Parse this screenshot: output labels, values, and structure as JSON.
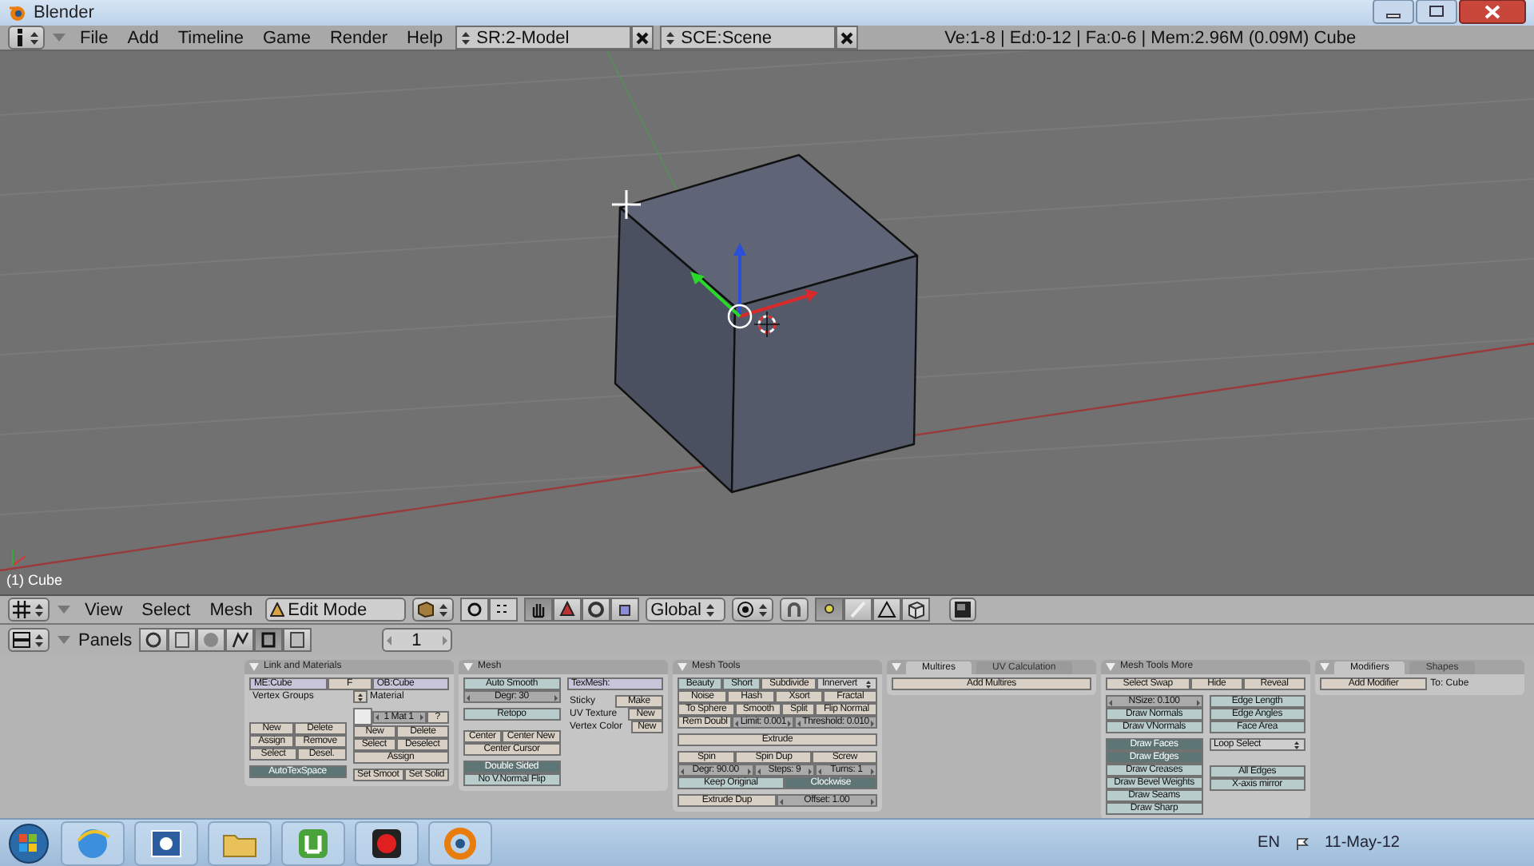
{
  "window": {
    "title": "Blender"
  },
  "info_header": {
    "menus": [
      "File",
      "Add",
      "Timeline",
      "Game",
      "Render",
      "Help"
    ],
    "screen": "SR:2-Model",
    "scene": "SCE:Scene",
    "stats": "Ve:1-8 | Ed:0-12 | Fa:0-6 | Mem:2.96M (0.09M) Cube"
  },
  "viewport": {
    "object_label": "(1) Cube"
  },
  "view_header": {
    "menus": [
      "View",
      "Select",
      "Mesh"
    ],
    "mode": "Edit Mode",
    "orientation": "Global",
    "tools": [
      {
        "selected": true
      },
      {
        "selected": false
      },
      {
        "selected": false
      },
      {
        "selected": false
      }
    ],
    "select_modes": [
      {
        "selected": true
      },
      {
        "selected": false
      },
      {
        "selected": false
      }
    ]
  },
  "buttons_header": {
    "label": "Panels",
    "contexts": [
      {
        "selected": false
      },
      {
        "selected": false
      },
      {
        "selected": false
      },
      {
        "selected": false
      },
      {
        "selected": true
      },
      {
        "selected": false
      }
    ],
    "frame": "1"
  },
  "panels": [
    {
      "title": "Link and Materials",
      "rows": [
        [
          {
            "kind": "field",
            "label": "ME:Cube"
          },
          {
            "kind": "button",
            "label": "F"
          },
          {
            "kind": "field",
            "label": "OB:Cube"
          }
        ]
      ],
      "left": {
        "rows": [
          [
            {
              "kind": "text",
              "label": "Vertex Groups"
            }
          ],
          [
            {
              "kind": "spacer"
            }
          ],
          [
            {
              "kind": "spacer"
            }
          ],
          [
            {
              "kind": "spacer"
            }
          ],
          [
            {
              "kind": "spacer"
            }
          ],
          [
            {
              "kind": "button",
              "label": "New"
            },
            {
              "kind": "button",
              "label": "Delete"
            }
          ],
          [
            {
              "kind": "button",
              "label": "Assign"
            },
            {
              "kind": "button",
              "label": "Remove"
            }
          ],
          [
            {
              "kind": "button",
              "label": "Select"
            },
            {
              "kind": "button",
              "label": "Desel."
            }
          ],
          [
            {
              "kind": "spacer"
            }
          ],
          [
            {
              "kind": "toggle",
              "label": "AutoTexSpace",
              "on": true
            }
          ]
        ]
      },
      "right": {
        "rows": [
          [
            {
              "kind": "menu_icon"
            },
            {
              "kind": "text",
              "label": "Material"
            }
          ],
          [
            {
              "kind": "spacer"
            }
          ],
          [
            {
              "kind": "swatch"
            },
            {
              "kind": "number",
              "label": "1 Mat 1"
            },
            {
              "kind": "button",
              "label": "?"
            }
          ],
          [
            {
              "kind": "button",
              "label": "New"
            },
            {
              "kind": "button",
              "label": "Delete"
            }
          ],
          [
            {
              "kind": "button",
              "label": "Select"
            },
            {
              "kind": "button",
              "label": "Deselect"
            }
          ],
          [
            {
              "kind": "button",
              "label": "Assign"
            }
          ],
          [
            {
              "kind": "spacer"
            }
          ],
          [
            {
              "kind": "button",
              "label": "Set Smoot"
            },
            {
              "kind": "button",
              "label": "Set Solid"
            }
          ]
        ]
      }
    },
    {
      "title": "Mesh",
      "left": {
        "rows": [
          [
            {
              "kind": "toggle",
              "label": "Auto Smooth",
              "on": false
            }
          ],
          [
            {
              "kind": "number",
              "label": "Degr: 30"
            }
          ],
          [
            {
              "kind": "spacer"
            }
          ],
          [
            {
              "kind": "toggle",
              "label": "Retopo",
              "on": false
            }
          ],
          [
            {
              "kind": "spacer"
            }
          ],
          [
            {
              "kind": "spacer"
            }
          ],
          [
            {
              "kind": "button",
              "label": "Center"
            },
            {
              "kind": "button",
              "label": "Center New"
            }
          ],
          [
            {
              "kind": "button",
              "label": "Center Cursor"
            }
          ],
          [
            {
              "kind": "spacer"
            }
          ],
          [
            {
              "kind": "toggle",
              "label": "Double Sided",
              "on": true
            }
          ],
          [
            {
              "kind": "toggle",
              "label": "No V.Normal Flip",
              "on": false
            }
          ]
        ]
      },
      "right": {
        "rows": [
          [
            {
              "kind": "field",
              "label": "TexMesh:"
            }
          ],
          [
            {
              "kind": "spacer"
            }
          ],
          [
            {
              "kind": "text",
              "label": "Sticky"
            },
            {
              "kind": "button",
              "label": "Make"
            }
          ],
          [
            {
              "kind": "text",
              "label": "UV Texture"
            },
            {
              "kind": "button",
              "label": "New"
            }
          ],
          [
            {
              "kind": "text",
              "label": "Vertex Color"
            },
            {
              "kind": "button",
              "label": "New"
            }
          ]
        ]
      }
    },
    {
      "title": "Mesh Tools",
      "rows": [
        [
          {
            "kind": "toggle",
            "label": "Beauty",
            "on": false
          },
          {
            "kind": "toggle",
            "label": "Short",
            "on": false
          },
          {
            "kind": "button",
            "label": "Subdivide"
          },
          {
            "kind": "menu",
            "label": "Innervert"
          }
        ],
        [
          {
            "kind": "button",
            "label": "Noise"
          },
          {
            "kind": "button",
            "label": "Hash"
          },
          {
            "kind": "button",
            "label": "Xsort"
          },
          {
            "kind": "button",
            "label": "Fractal"
          }
        ],
        [
          {
            "kind": "button",
            "label": "To Sphere"
          },
          {
            "kind": "button",
            "label": "Smooth"
          },
          {
            "kind": "button",
            "label": "Split"
          },
          {
            "kind": "button",
            "label": "Flip Normal"
          }
        ],
        [
          {
            "kind": "button",
            "label": "Rem Doubl"
          },
          {
            "kind": "number",
            "label": "Limit: 0.001"
          },
          {
            "kind": "number",
            "label": "Threshold: 0.010"
          }
        ],
        [
          {
            "kind": "spacer"
          }
        ],
        [
          {
            "kind": "button",
            "label": "Extrude"
          }
        ],
        [
          {
            "kind": "spacer"
          }
        ],
        [
          {
            "kind": "button",
            "label": "Spin"
          },
          {
            "kind": "button",
            "label": "Spin Dup"
          },
          {
            "kind": "button",
            "label": "Screw"
          }
        ],
        [
          {
            "kind": "number",
            "label": "Degr: 90.00"
          },
          {
            "kind": "number",
            "label": "Steps: 9"
          },
          {
            "kind": "number",
            "label": "Turns: 1"
          }
        ],
        [
          {
            "kind": "toggle",
            "label": "Keep Original",
            "on": false
          },
          {
            "kind": "toggle",
            "label": "Clockwise",
            "on": true
          }
        ],
        [
          {
            "kind": "spacer"
          }
        ],
        [
          {
            "kind": "button",
            "label": "Extrude Dup"
          },
          {
            "kind": "number",
            "label": "Offset: 1.00"
          }
        ]
      ]
    },
    {
      "tabs": [
        {
          "label": "Multires",
          "selected": true
        },
        {
          "label": "UV Calculation",
          "selected": false
        }
      ],
      "rows": [
        [
          {
            "kind": "button",
            "label": "Add Multires"
          }
        ]
      ]
    },
    {
      "title": "Mesh Tools More",
      "rows": [
        [
          {
            "kind": "button",
            "label": "Select Swap"
          },
          {
            "kind": "button",
            "label": "Hide"
          },
          {
            "kind": "button",
            "label": "Reveal"
          }
        ],
        [
          {
            "kind": "spacer"
          }
        ]
      ],
      "left": {
        "rows": [
          [
            {
              "kind": "number",
              "label": "NSize: 0.100"
            }
          ],
          [
            {
              "kind": "toggle",
              "label": "Draw Normals",
              "on": false
            }
          ],
          [
            {
              "kind": "toggle",
              "label": "Draw VNormals",
              "on": false
            }
          ],
          [
            {
              "kind": "spacer"
            }
          ],
          [
            {
              "kind": "toggle",
              "label": "Draw Faces",
              "on": true
            }
          ],
          [
            {
              "kind": "toggle",
              "label": "Draw Edges",
              "on": true
            }
          ],
          [
            {
              "kind": "toggle",
              "label": "Draw Creases",
              "on": false
            }
          ],
          [
            {
              "kind": "toggle",
              "label": "Draw Bevel Weights",
              "on": false
            }
          ],
          [
            {
              "kind": "toggle",
              "label": "Draw Seams",
              "on": false
            }
          ],
          [
            {
              "kind": "toggle",
              "label": "Draw Sharp",
              "on": false
            }
          ]
        ]
      },
      "right": {
        "rows": [
          [
            {
              "kind": "toggle",
              "label": "Edge Length",
              "on": false
            }
          ],
          [
            {
              "kind": "toggle",
              "label": "Edge Angles",
              "on": false
            }
          ],
          [
            {
              "kind": "toggle",
              "label": "Face Area",
              "on": false
            }
          ],
          [
            {
              "kind": "spacer"
            }
          ],
          [
            {
              "kind": "menu",
              "label": "Loop Select"
            }
          ],
          [
            {
              "kind": "spacer"
            }
          ],
          [
            {
              "kind": "spacer"
            }
          ],
          [
            {
              "kind": "spacer"
            }
          ],
          [
            {
              "kind": "toggle",
              "label": "All Edges",
              "on": false
            }
          ],
          [
            {
              "kind": "toggle",
              "label": "X-axis mirror",
              "on": false
            }
          ]
        ]
      }
    },
    {
      "tabs": [
        {
          "label": "Modifiers",
          "selected": true
        },
        {
          "label": "Shapes",
          "selected": false
        }
      ],
      "rows": [
        [
          {
            "kind": "button",
            "label": "Add Modifier"
          },
          {
            "kind": "text",
            "label": "To: Cube"
          }
        ]
      ]
    }
  ],
  "taskbar": {
    "language": "EN",
    "date": "11-May-12"
  }
}
